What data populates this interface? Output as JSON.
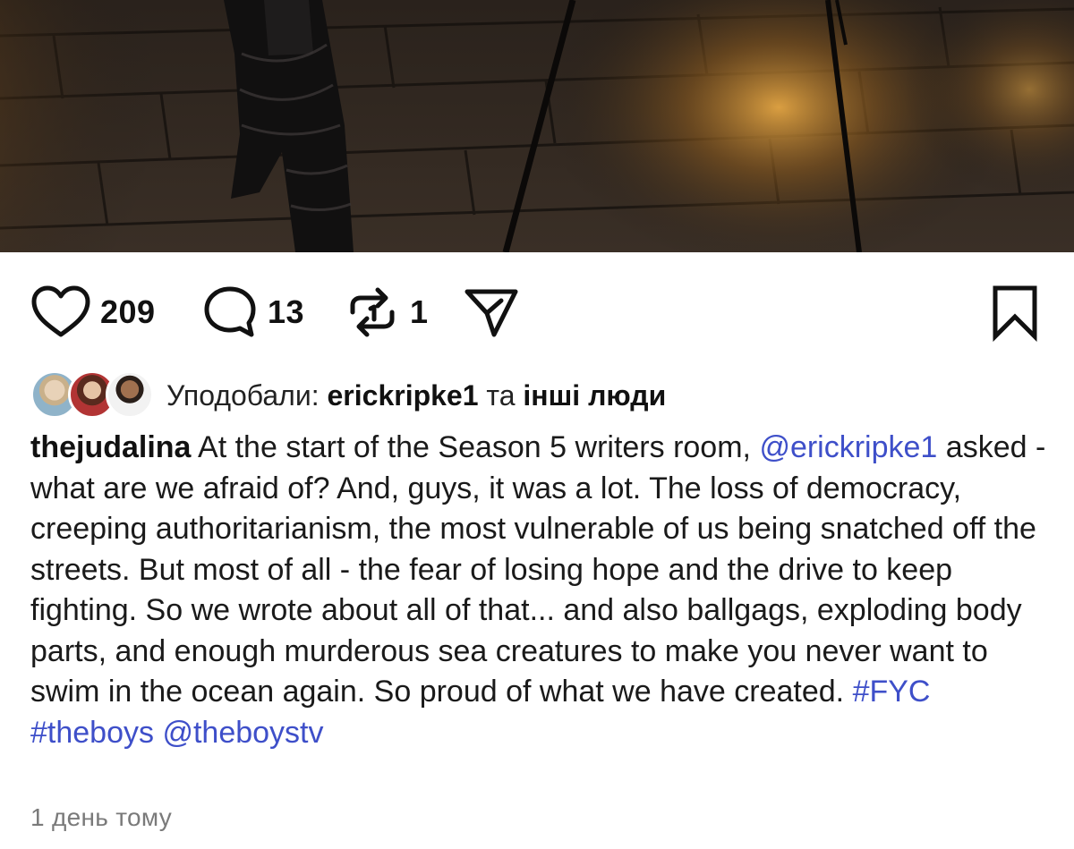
{
  "post": {
    "likes_count": "209",
    "comments_count": "13",
    "reposts_count": "1",
    "liked_by_prefix": "Уподобали: ",
    "liked_by_user": "erickripke1",
    "liked_by_conj": " та ",
    "liked_by_others": "інші люди",
    "author": "thejudalina",
    "caption_parts": [
      " At the start of the Season 5 writers room, ",
      " asked - what are we afraid of? And, guys, it was a lot. The loss of democracy, creeping authoritarianism, the most vulnerable of us being snatched off the streets. But most of all - the fear of losing hope and the drive to keep fighting. So we wrote about all of that... and also ballgags, exploding body parts, and enough murderous sea creatures to make you never want to swim in the ocean again. So proud of what we have created. "
    ],
    "mention_1": "@erickripke1",
    "hashtag_1": "#FYC",
    "hashtag_2": "#theboys",
    "mention_2": "@theboystv",
    "timestamp": "1 день тому"
  },
  "icons": {
    "like": "heart-icon",
    "comment": "comment-icon",
    "repost": "repost-icon",
    "share": "send-icon",
    "save": "bookmark-icon"
  },
  "colors": {
    "link": "#3e4fc9",
    "timestamp": "#7a7a7a"
  }
}
